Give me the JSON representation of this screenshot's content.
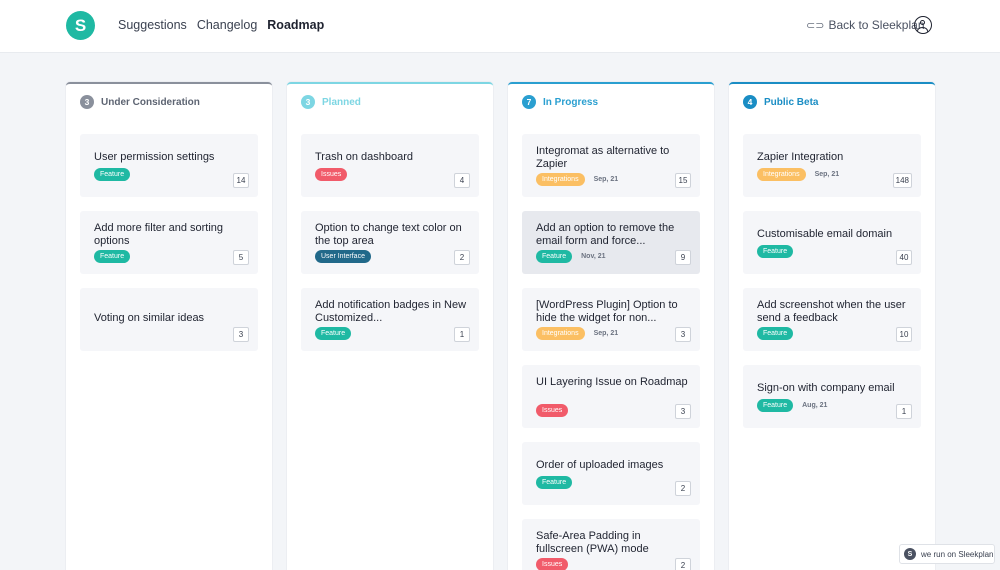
{
  "header": {
    "logo_letter": "S",
    "nav": [
      {
        "label": "Suggestions",
        "active": false
      },
      {
        "label": "Changelog",
        "active": false
      },
      {
        "label": "Roadmap",
        "active": true
      }
    ],
    "back_label": "Back to Sleekplan"
  },
  "columns": [
    {
      "title": "Under Consideration",
      "count": "3",
      "color": "#8a909c",
      "cards": [
        {
          "title": "User permission settings",
          "tag": "Feature",
          "tag_color": "#1fb9a3",
          "date": "",
          "votes": "14"
        },
        {
          "title": "Add more filter and sorting options",
          "tag": "Feature",
          "tag_color": "#1fb9a3",
          "date": "",
          "votes": "5"
        },
        {
          "title": "Voting on similar ideas",
          "tag": "",
          "tag_color": "",
          "date": "",
          "votes": "3"
        }
      ]
    },
    {
      "title": "Planned",
      "count": "3",
      "color": "#7dd6e3",
      "cards": [
        {
          "title": "Trash on dashboard",
          "tag": "Issues",
          "tag_color": "#f15b6a",
          "date": "",
          "votes": "4"
        },
        {
          "title": "Option to change text color on the top area",
          "tag": "User Interface",
          "tag_color": "#21698a",
          "date": "",
          "votes": "2"
        },
        {
          "title": "Add notification badges in New Customized...",
          "tag": "Feature",
          "tag_color": "#1fb9a3",
          "date": "",
          "votes": "1"
        }
      ]
    },
    {
      "title": "In Progress",
      "count": "7",
      "color": "#2a9fd0",
      "cards": [
        {
          "title": "Integromat as alternative to Zapier",
          "tag": "Integrations",
          "tag_color": "#fbbf63",
          "date": "Sep, 21",
          "votes": "15"
        },
        {
          "title": "Add an option to remove the email form and force...",
          "tag": "Feature",
          "tag_color": "#1fb9a3",
          "date": "Nov, 21",
          "votes": "9"
        },
        {
          "title": "[WordPress Plugin] Option to hide the widget for non...",
          "tag": "Integrations",
          "tag_color": "#fbbf63",
          "date": "Sep, 21",
          "votes": "3"
        },
        {
          "title": "UI Layering Issue on Roadmap",
          "tag": "Issues",
          "tag_color": "#f15b6a",
          "date": "",
          "votes": "3"
        },
        {
          "title": "Order of uploaded images",
          "tag": "Feature",
          "tag_color": "#1fb9a3",
          "date": "",
          "votes": "2"
        },
        {
          "title": "Safe-Area Padding in fullscreen (PWA) mode",
          "tag": "Issues",
          "tag_color": "#f15b6a",
          "date": "",
          "votes": "2"
        }
      ]
    },
    {
      "title": "Public Beta",
      "count": "4",
      "color": "#1a8dc4",
      "cards": [
        {
          "title": "Zapier Integration",
          "tag": "Integrations",
          "tag_color": "#fbbf63",
          "date": "Sep, 21",
          "votes": "148"
        },
        {
          "title": "Customisable email domain",
          "tag": "Feature",
          "tag_color": "#1fb9a3",
          "date": "",
          "votes": "40"
        },
        {
          "title": "Add screenshot when the user send a feedback",
          "tag": "Feature",
          "tag_color": "#1fb9a3",
          "date": "",
          "votes": "10"
        },
        {
          "title": "Sign-on with company email",
          "tag": "Feature",
          "tag_color": "#1fb9a3",
          "date": "Aug, 21",
          "votes": "1"
        }
      ]
    }
  ],
  "footer_badge": {
    "logo_letter": "S",
    "label": "we run on Sleekplan"
  }
}
